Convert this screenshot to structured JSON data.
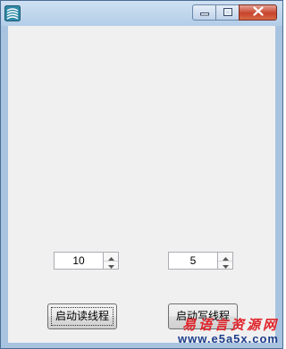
{
  "window": {
    "title": "",
    "icon": "app-icon",
    "caption_buttons": [
      "minimize-icon",
      "maximize-icon",
      "close-icon"
    ]
  },
  "spinners": [
    {
      "value": "10"
    },
    {
      "value": "5"
    }
  ],
  "buttons": {
    "start_read": "启动读线程",
    "start_write": "启动写线程"
  },
  "watermark": {
    "title": "易语言资源网",
    "url": "www.e5a5x.com"
  }
}
